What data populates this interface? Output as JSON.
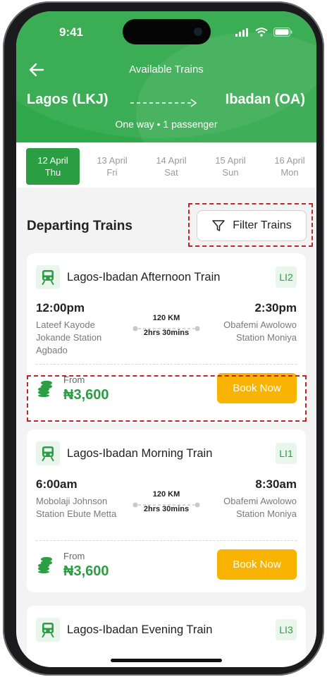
{
  "status": {
    "time": "9:41"
  },
  "header": {
    "title": "Available Trains",
    "from": "Lagos (LKJ)",
    "to": "Ibadan (OA)",
    "subtitle": "One way  •  1 passenger"
  },
  "dates": [
    {
      "day": "12 April",
      "weekday": "Thu",
      "selected": true
    },
    {
      "day": "13 April",
      "weekday": "Fri",
      "selected": false
    },
    {
      "day": "14 April",
      "weekday": "Sat",
      "selected": false
    },
    {
      "day": "15 April",
      "weekday": "Sun",
      "selected": false
    },
    {
      "day": "16 April",
      "weekday": "Mon",
      "selected": false
    }
  ],
  "section_title": "Departing Trains",
  "filter_label": "Filter Trains",
  "trains": [
    {
      "name": "Lagos-Ibadan Afternoon Train",
      "code": "LI2",
      "dep_time": "12:00pm",
      "arr_time": "2:30pm",
      "dep_station": "Lateef Kayode Jokande Station Agbado",
      "arr_station": "Obafemi Awolowo Station Moniya",
      "distance": "120 KM",
      "duration": "2hrs 30mins",
      "from_label": "From",
      "price": "₦3,600",
      "book_label": "Book Now"
    },
    {
      "name": "Lagos-Ibadan Morning Train",
      "code": "LI1",
      "dep_time": "6:00am",
      "arr_time": "8:30am",
      "dep_station": "Mobolaji Johnson Station Ebute Metta",
      "arr_station": "Obafemi Awolowo Station Moniya",
      "distance": "120 KM",
      "duration": "2hrs 30mins",
      "from_label": "From",
      "price": "₦3,600",
      "book_label": "Book Now"
    },
    {
      "name": "Lagos-Ibadan Evening Train",
      "code": "LI3"
    }
  ],
  "colors": {
    "primary": "#2fa84a",
    "accent": "#f9b403",
    "highlight": "#c0242c"
  }
}
